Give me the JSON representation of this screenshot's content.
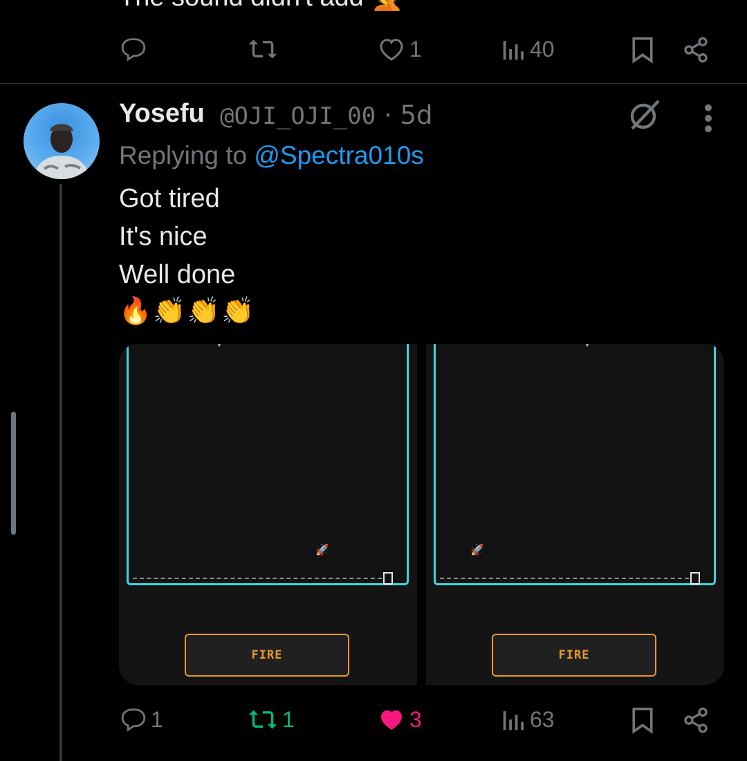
{
  "previous_tweet": {
    "text": "The sound didn't add 🤦",
    "actions": {
      "replies": "",
      "retweets": "",
      "likes": "1",
      "views": "40"
    }
  },
  "tweet": {
    "display_name": "Yosefu",
    "handle": "@OJI_OJI_00",
    "separator": "·",
    "time": "5d",
    "replying_prefix": "Replying to ",
    "replying_to": "@Spectra010s",
    "lines": [
      "Got tired",
      "It's nice",
      "Well done"
    ],
    "emojis": "🔥👏👏👏",
    "media": [
      {
        "button_label": "FIRE",
        "rocket": "🚀"
      },
      {
        "button_label": "FIRE",
        "rocket": "🚀"
      }
    ],
    "actions": {
      "replies": "1",
      "retweets": "1",
      "likes": "3",
      "views": "63"
    }
  },
  "colors": {
    "accent": "#1d9bf0",
    "retweet_green": "#00ba7c",
    "like_pink": "#f91880",
    "muted": "#71767b",
    "game_cyan": "#3fd6e0",
    "fire_orange": "#e89a2a"
  },
  "icons": [
    "reply-icon",
    "retweet-icon",
    "heart-icon",
    "views-icon",
    "bookmark-icon",
    "share-icon",
    "grok-icon",
    "more-icon"
  ]
}
